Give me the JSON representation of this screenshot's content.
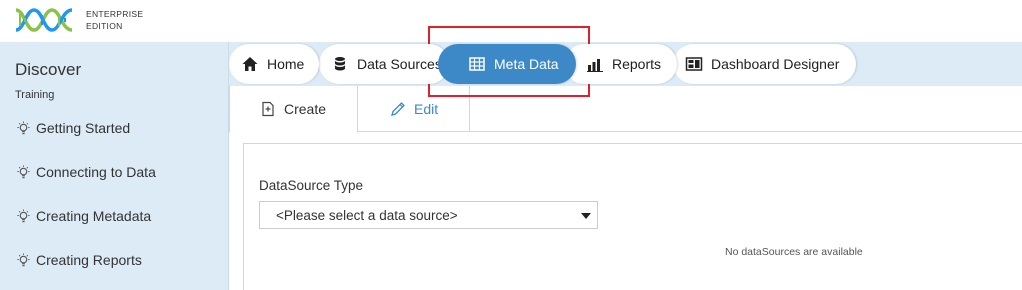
{
  "brand": {
    "edition_line1": "ENTERPRISE",
    "edition_line2": "EDITION",
    "logo_colors": [
      "#8bc34a",
      "#2196f3"
    ]
  },
  "sidebar": {
    "title": "Discover",
    "subtitle": "Training",
    "items": [
      {
        "label": "Getting Started",
        "icon": "lightbulb-icon"
      },
      {
        "label": "Connecting to Data",
        "icon": "lightbulb-icon"
      },
      {
        "label": "Creating Metadata",
        "icon": "lightbulb-icon"
      },
      {
        "label": "Creating Reports",
        "icon": "lightbulb-icon"
      }
    ]
  },
  "nav": {
    "tabs": [
      {
        "label": "Home",
        "icon": "home-icon"
      },
      {
        "label": "Data Sources",
        "icon": "database-icon"
      },
      {
        "label": "Meta Data",
        "icon": "table-icon",
        "active": true
      },
      {
        "label": "Reports",
        "icon": "bar-chart-icon"
      },
      {
        "label": "Dashboard Designer",
        "icon": "dashboard-icon"
      }
    ],
    "active_color": "#3d89c8"
  },
  "subtabs": {
    "create": "Create",
    "edit": "Edit"
  },
  "form": {
    "datasource_label": "DataSource Type",
    "datasource_selected": "<Please select a data source>",
    "empty_message": "No dataSources are available"
  },
  "colors": {
    "sidebar_bg": "#dcebf6",
    "highlight": "#e0202c"
  }
}
